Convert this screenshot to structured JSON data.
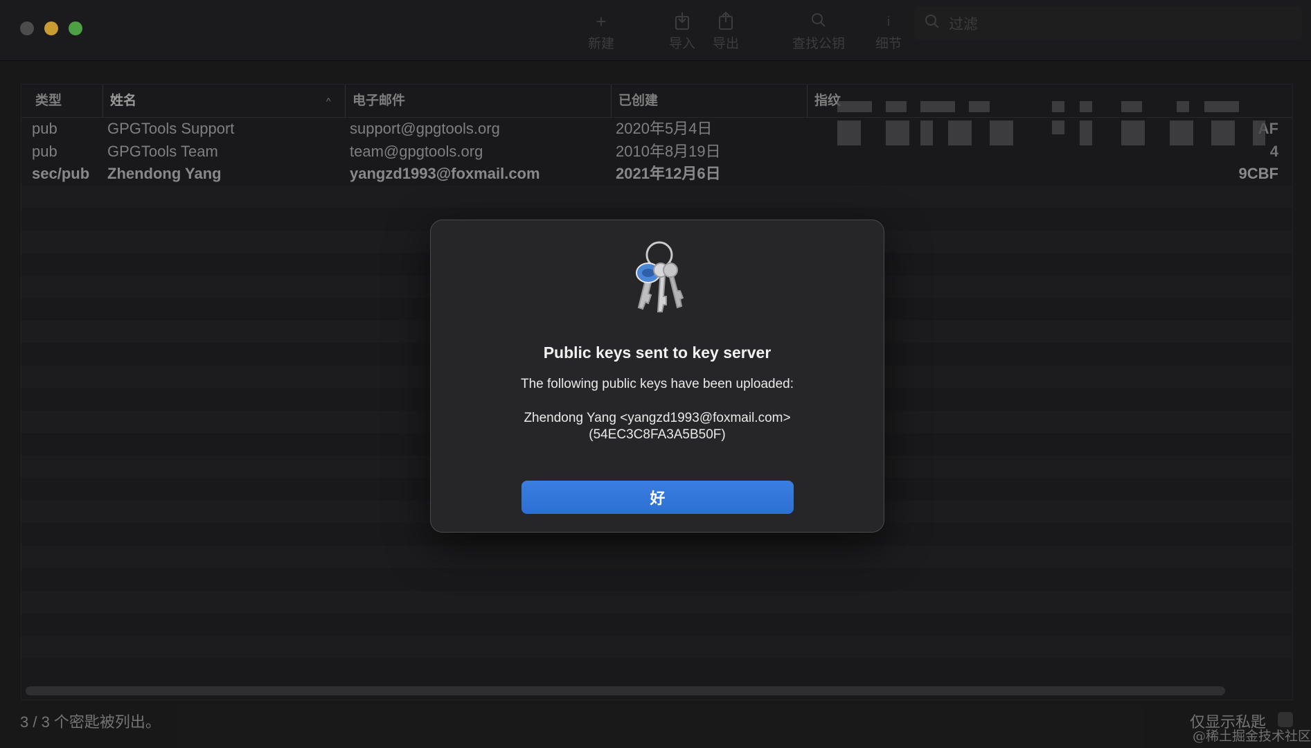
{
  "toolbar": {
    "new_label": "新建",
    "import_label": "导入",
    "export_label": "导出",
    "lookup_label": "查找公钥",
    "details_label": "细节",
    "search_placeholder": "过滤"
  },
  "table": {
    "columns": [
      "类型",
      "姓名",
      "电子邮件",
      "已创建",
      "指纹"
    ],
    "rows": [
      {
        "type": "pub",
        "name": "GPGTools Support",
        "email": "support@gpgtools.org",
        "created": "2020年5月4日",
        "fp_tail": "AF",
        "bold": false
      },
      {
        "type": "pub",
        "name": "GPGTools Team",
        "email": "team@gpgtools.org",
        "created": "2010年8月19日",
        "fp_tail": "4",
        "bold": false
      },
      {
        "type": "sec/pub",
        "name": "Zhendong Yang",
        "email": "yangzd1993@foxmail.com",
        "created": "2021年12月6日",
        "fp_tail": "9CBF",
        "bold": true
      }
    ]
  },
  "footer": {
    "count_text": "3 / 3 个密匙被列出。",
    "private_only_label": "仅显示私匙",
    "watermark": "@稀土掘金技术社区"
  },
  "dialog": {
    "title": "Public keys sent to key server",
    "message": "The following public keys have been uploaded:",
    "key_line1": "Zhendong Yang <yangzd1993@foxmail.com>",
    "key_line2": "(54EC3C8FA3A5B50F)",
    "ok_label": "好"
  }
}
